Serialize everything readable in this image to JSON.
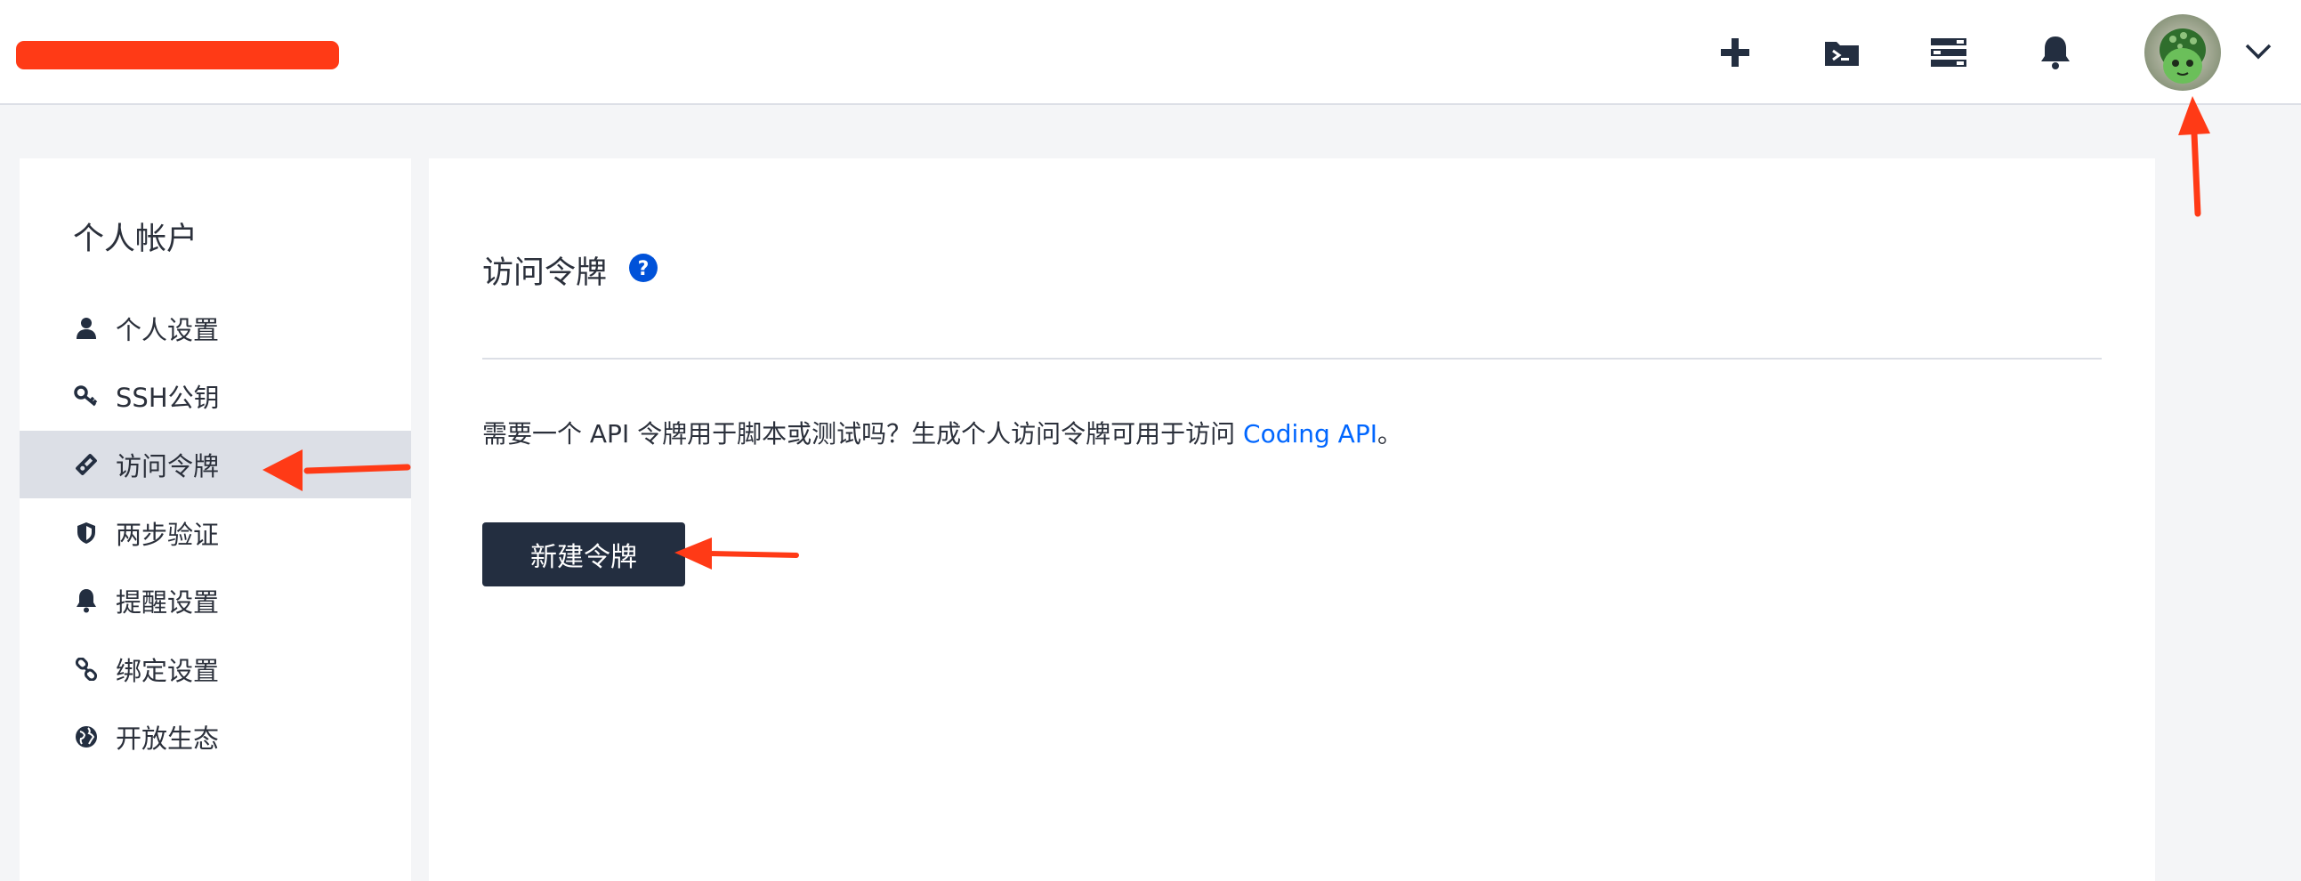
{
  "header": {
    "icons": [
      "plus-icon",
      "folder-terminal-icon",
      "server-stack-icon",
      "bell-icon"
    ],
    "avatar": "avatar",
    "dropdown_icon": "chevron-down-icon"
  },
  "sidebar": {
    "title": "个人帐户",
    "items": [
      {
        "label": "个人设置",
        "icon": "user-icon"
      },
      {
        "label": "SSH公钥",
        "icon": "key-icon"
      },
      {
        "label": "访问令牌",
        "icon": "ticket-icon",
        "active": true
      },
      {
        "label": "两步验证",
        "icon": "shield-icon"
      },
      {
        "label": "提醒设置",
        "icon": "bell-icon"
      },
      {
        "label": "绑定设置",
        "icon": "link-icon"
      },
      {
        "label": "开放生态",
        "icon": "globe-icon"
      }
    ]
  },
  "main": {
    "title": "访问令牌",
    "description_prefix": "需要一个 API 令牌用于脚本或测试吗？生成个人访问令牌可用于访问 ",
    "description_link": "Coding API",
    "description_suffix": "。",
    "button_label": "新建令牌"
  },
  "colors": {
    "accent_dark": "#232e40",
    "link": "#0066ff",
    "annotation": "#ff3a16",
    "active_bg": "#dcdfe6"
  }
}
